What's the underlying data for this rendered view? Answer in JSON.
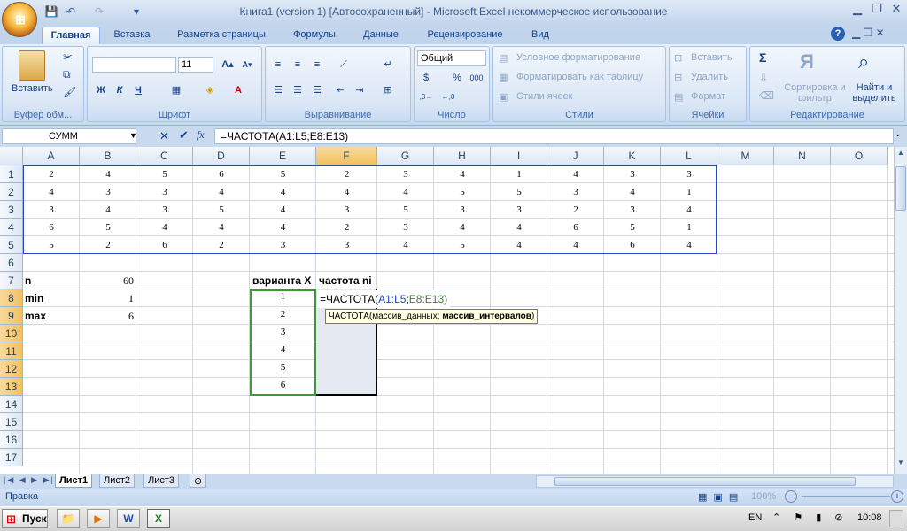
{
  "title": "Книга1 (version 1) [Автосохраненный] - Microsoft Excel некоммерческое использование",
  "tabs": [
    "Главная",
    "Вставка",
    "Разметка страницы",
    "Формулы",
    "Данные",
    "Рецензирование",
    "Вид"
  ],
  "ribbon": {
    "clipboard": {
      "paste": "Вставить",
      "label": "Буфер обм..."
    },
    "font": {
      "size": "11",
      "bold": "Ж",
      "italic": "К",
      "underline": "Ч",
      "label": "Шрифт"
    },
    "align": {
      "label": "Выравнивание"
    },
    "number": {
      "format": "Общий",
      "percent": "%",
      "thousands": "000",
      "label": "Число"
    },
    "styles": {
      "cond": "Условное форматирование",
      "table": "Форматировать как таблицу",
      "cell": "Стили ячеек",
      "label": "Стили"
    },
    "cells": {
      "insert": "Вставить",
      "delete": "Удалить",
      "format": "Формат",
      "label": "Ячейки"
    },
    "editing": {
      "sort": "Сортировка и фильтр",
      "find": "Найти и выделить",
      "label": "Редактирование"
    }
  },
  "formula_bar": {
    "name": "СУММ",
    "formula": "=ЧАСТОТА(A1:L5;E8:E13)"
  },
  "columns": [
    "A",
    "B",
    "C",
    "D",
    "E",
    "F",
    "G",
    "H",
    "I",
    "J",
    "K",
    "L",
    "M",
    "N",
    "O"
  ],
  "rows": [
    "1",
    "2",
    "3",
    "4",
    "5",
    "6",
    "7",
    "8",
    "9",
    "10",
    "11",
    "12",
    "13",
    "14",
    "15",
    "16",
    "17"
  ],
  "data_rows": [
    [
      "2",
      "4",
      "5",
      "6",
      "5",
      "2",
      "3",
      "4",
      "1",
      "4",
      "3",
      "3"
    ],
    [
      "4",
      "3",
      "3",
      "4",
      "4",
      "4",
      "4",
      "5",
      "5",
      "3",
      "4",
      "1"
    ],
    [
      "3",
      "4",
      "3",
      "5",
      "4",
      "3",
      "5",
      "3",
      "3",
      "2",
      "3",
      "4"
    ],
    [
      "6",
      "5",
      "4",
      "4",
      "4",
      "2",
      "3",
      "4",
      "4",
      "6",
      "5",
      "1"
    ],
    [
      "5",
      "2",
      "6",
      "2",
      "3",
      "3",
      "4",
      "5",
      "4",
      "4",
      "6",
      "4"
    ]
  ],
  "stats": [
    {
      "label": "n",
      "value": "60"
    },
    {
      "label": "min",
      "value": "1"
    },
    {
      "label": "max",
      "value": "6"
    }
  ],
  "freq": {
    "header_x": "варианта X",
    "header_n": "частота ni",
    "variants": [
      "1",
      "2",
      "3",
      "4",
      "5",
      "6"
    ],
    "edit_prefix": "=ЧАСТОТА(",
    "edit_ref1": "A1:L5",
    "edit_sep": ";",
    "edit_ref2": "E8:E13",
    "edit_suffix": ")",
    "tooltip_fn": "ЧАСТОТА(",
    "tooltip_a": "массив_данных; ",
    "tooltip_b": "массив_интервалов",
    ")": ")",
    "tooltip_close": ")"
  },
  "sheets": [
    "Лист1",
    "Лист2",
    "Лист3"
  ],
  "status": {
    "mode": "Правка",
    "zoom": "100%"
  },
  "taskbar": {
    "start": "Пуск",
    "lang": "EN",
    "time": "10:08"
  },
  "colors": {
    "ref1": "#1f3fcf",
    "ref2": "#2e8b2e"
  }
}
